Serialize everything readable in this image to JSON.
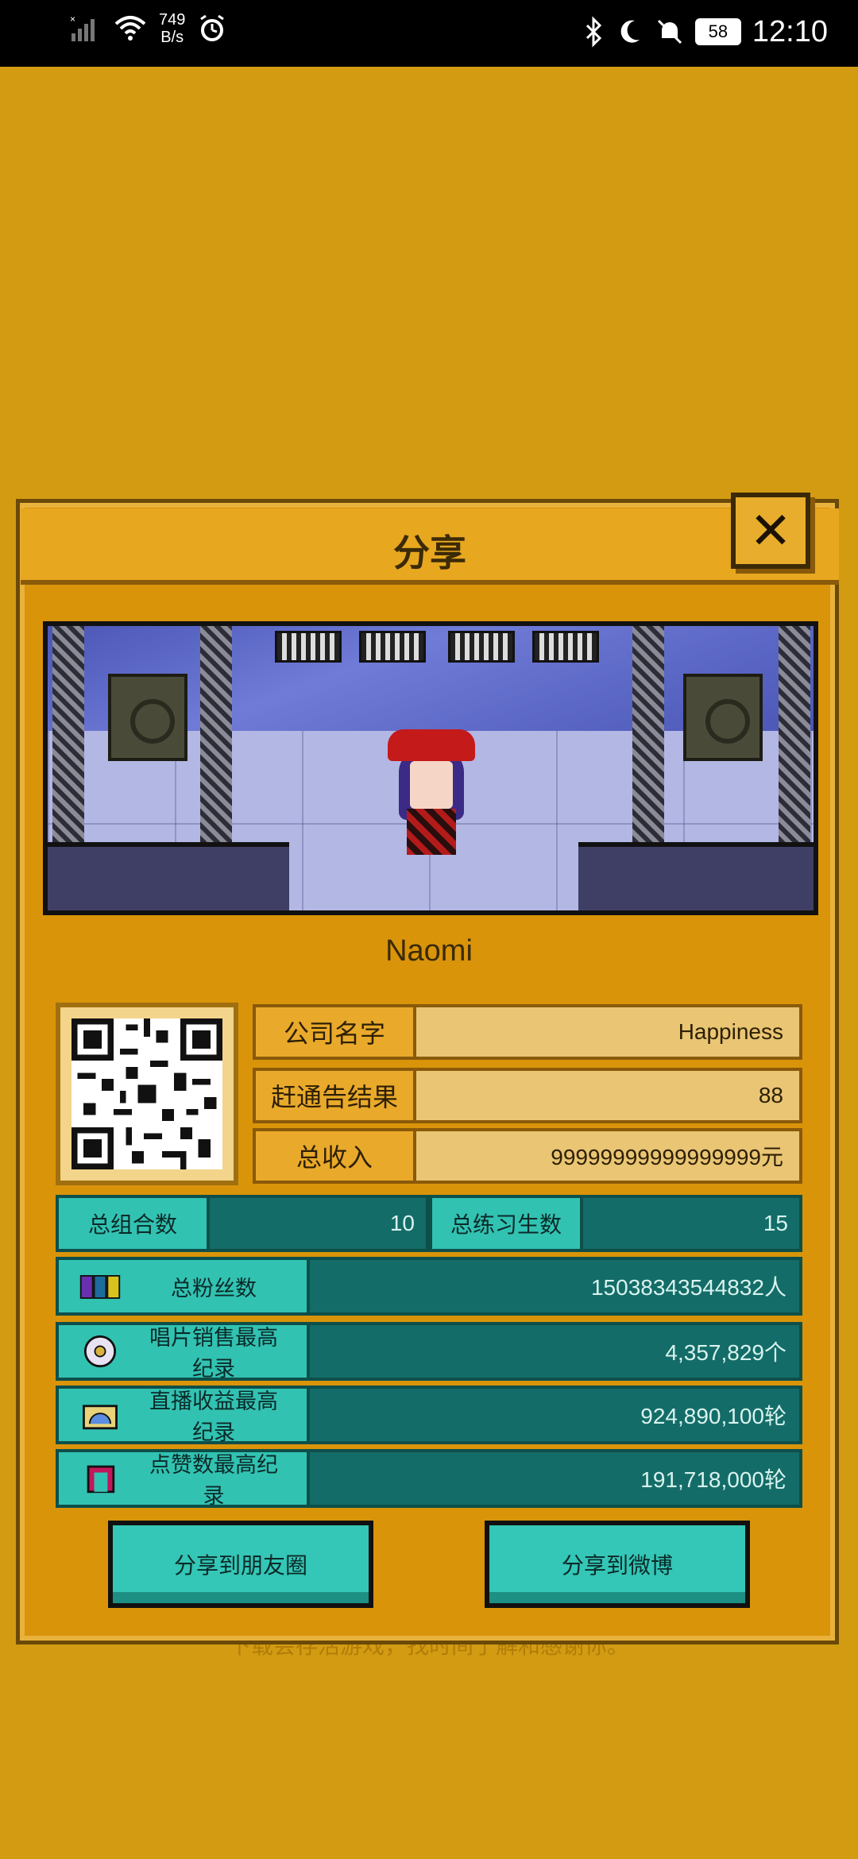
{
  "status_bar": {
    "speed_value": "749",
    "speed_unit": "B/s",
    "battery": "58",
    "time": "12:10"
  },
  "dialog": {
    "title": "分享",
    "close_label": "✕"
  },
  "player": {
    "name": "Naomi"
  },
  "company_info": [
    {
      "label": "公司名字",
      "value": "Happiness"
    },
    {
      "label": "赶通告结果",
      "value": "88"
    },
    {
      "label": "总收入",
      "value": "99999999999999999元"
    }
  ],
  "counts": [
    {
      "label": "总组合数",
      "value": "10"
    },
    {
      "label": "总练习生数",
      "value": "15"
    }
  ],
  "stats": [
    {
      "label": "总粉丝数",
      "value": "15038343544832人",
      "icon": "fans-icon"
    },
    {
      "label": "唱片销售最高纪录",
      "value": "4,357,829个",
      "icon": "disc-icon"
    },
    {
      "label": "直播收益最高纪录",
      "value": "924,890,100轮",
      "icon": "live-icon"
    },
    {
      "label": "点赞数最高纪录",
      "value": "191,718,000轮",
      "icon": "like-icon"
    }
  ],
  "buttons": {
    "share_moments": "分享到朋友圈",
    "share_weibo": "分享到微博"
  },
  "background_hint": "下载会存活游戏，找时间了解和感谢你。",
  "colors": {
    "background": "#d39b12",
    "panel": "#d9940a",
    "teal": "#32c2b2",
    "teal_dark": "#146c68"
  }
}
